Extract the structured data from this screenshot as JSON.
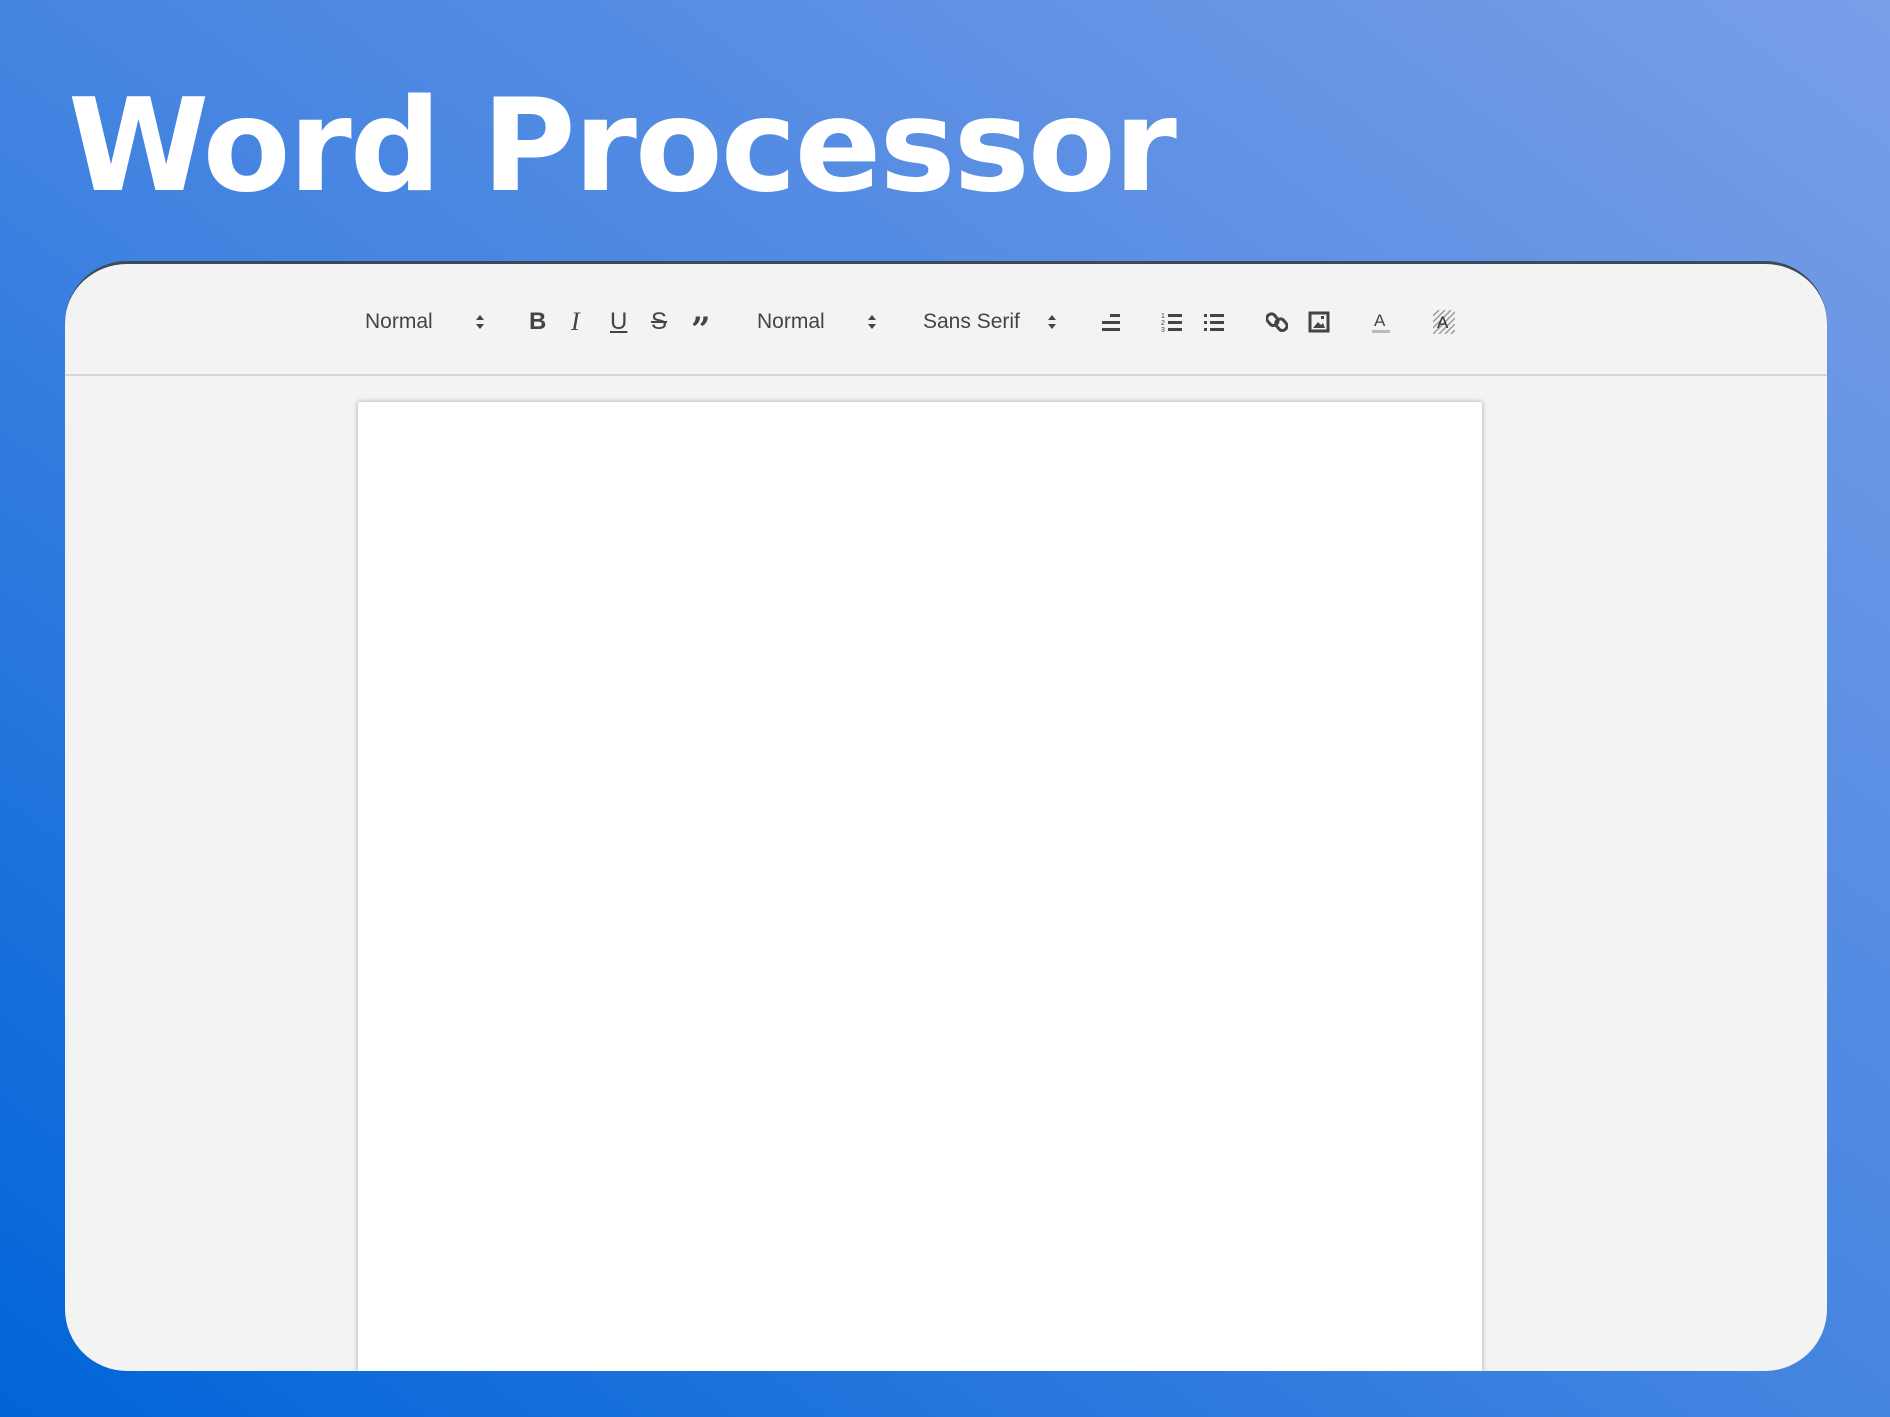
{
  "title": "Word Processor",
  "toolbar": {
    "heading_select": "Normal",
    "size_select": "Normal",
    "font_select": "Sans Serif",
    "bold": "B",
    "italic": "I",
    "underline": "U",
    "strike": "S"
  },
  "colors": {
    "bg_start": "#0064d8",
    "bg_end": "#7a9ee8",
    "panel": "#f3f3f3",
    "page": "#ffffff"
  }
}
